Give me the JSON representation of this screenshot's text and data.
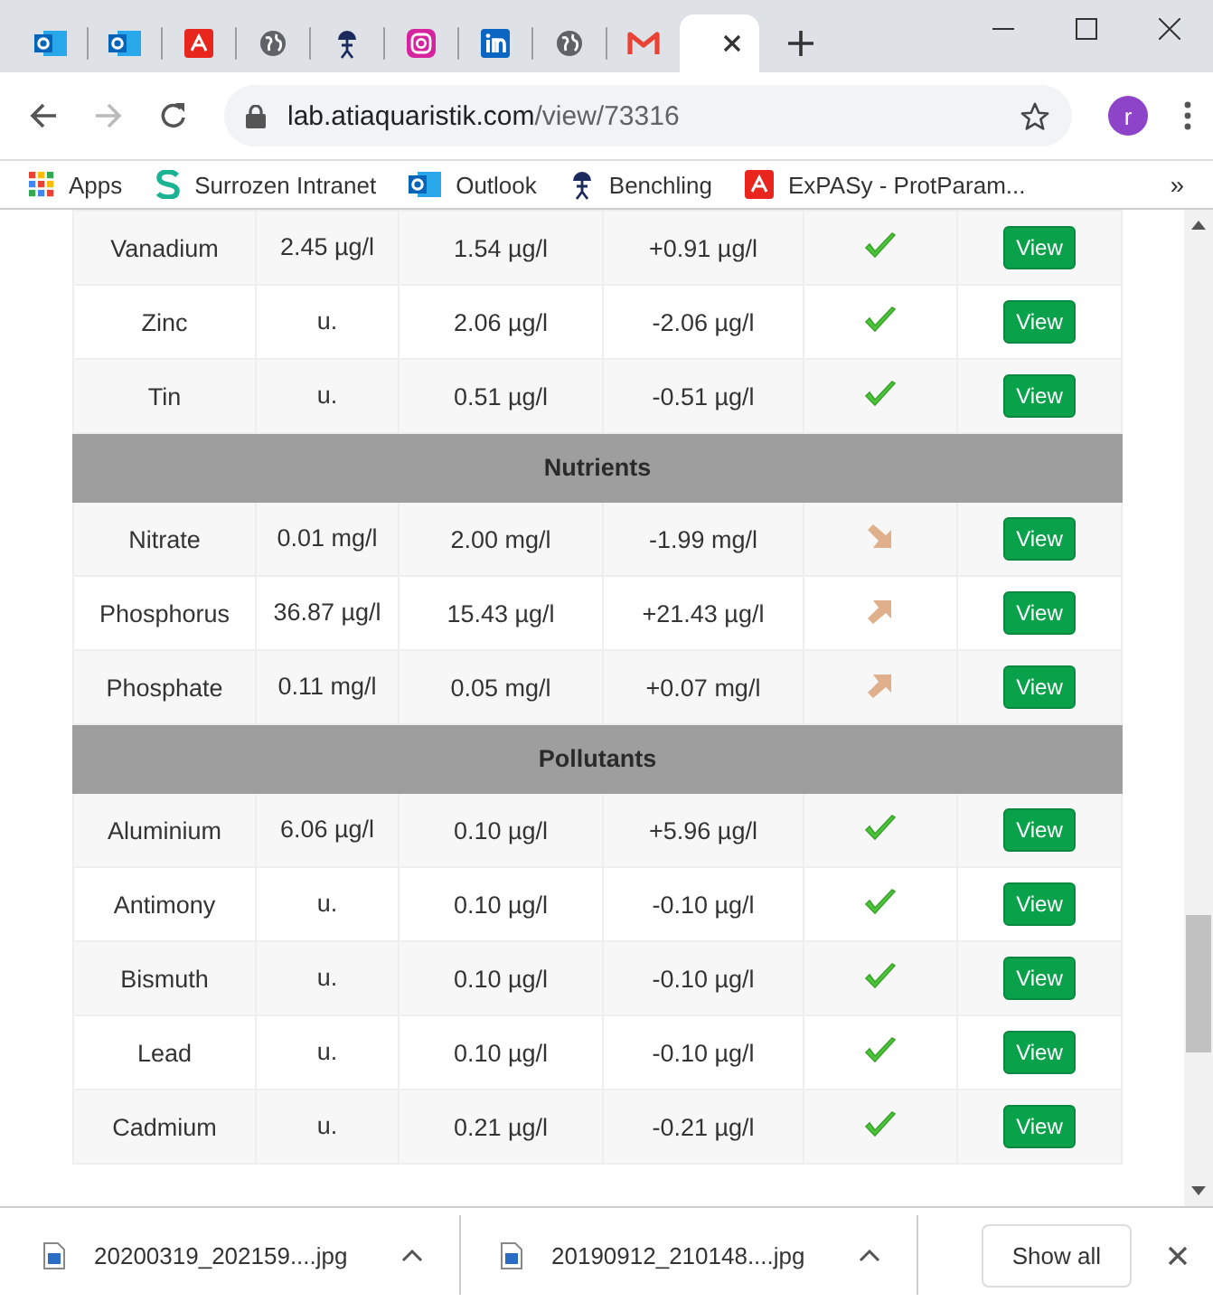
{
  "browser": {
    "tabs": [
      {
        "kind": "outlook",
        "selected": false
      },
      {
        "kind": "outlook",
        "selected": false
      },
      {
        "kind": "pdf",
        "selected": false
      },
      {
        "kind": "globe",
        "selected": false
      },
      {
        "kind": "figure",
        "selected": false
      },
      {
        "kind": "instagram",
        "selected": false
      },
      {
        "kind": "linkedin",
        "selected": false
      },
      {
        "kind": "globe",
        "selected": false
      },
      {
        "kind": "gmail",
        "selected": false
      },
      {
        "kind": "blank",
        "selected": true
      }
    ],
    "address": {
      "host": "lab.atiaquaristik.com",
      "path": "/view/73316"
    },
    "profile": "r",
    "bookmarks": [
      {
        "kind": "apps",
        "label": "Apps"
      },
      {
        "kind": "s",
        "label": "Surrozen Intranet"
      },
      {
        "kind": "outlook",
        "label": "Outlook"
      },
      {
        "kind": "figure",
        "label": "Benchling"
      },
      {
        "kind": "pdf",
        "label": "ExPASy - ProtParam..."
      }
    ],
    "bookmarks_more": "»"
  },
  "table": {
    "rows": [
      {
        "kind": "row",
        "name": "Vanadium",
        "measured": "2.45 µg/l",
        "target": "1.54 µg/l",
        "deviation": "+0.91 µg/l",
        "indicator": {
          "kind": "check"
        },
        "action": "View"
      },
      {
        "kind": "row",
        "name": "Zinc",
        "measured": "u.",
        "target": "2.06 µg/l",
        "deviation": "-2.06 µg/l",
        "indicator": {
          "kind": "check"
        },
        "action": "View"
      },
      {
        "kind": "row",
        "name": "Tin",
        "measured": "u.",
        "target": "0.51 µg/l",
        "deviation": "-0.51 µg/l",
        "indicator": {
          "kind": "check"
        },
        "action": "View"
      },
      {
        "kind": "group",
        "title": "Nutrients"
      },
      {
        "kind": "row",
        "name": "Nitrate",
        "measured": "0.01 mg/l",
        "target": "2.00 mg/l",
        "deviation": "-1.99 mg/l",
        "indicator": {
          "kind": "arrow_down"
        },
        "action": "View"
      },
      {
        "kind": "row",
        "name": "Phosphorus",
        "measured": "36.87 µg/l",
        "target": "15.43 µg/l",
        "deviation": "+21.43 µg/l",
        "indicator": {
          "kind": "arrow_up"
        },
        "action": "View"
      },
      {
        "kind": "row",
        "name": "Phosphate",
        "measured": "0.11 mg/l",
        "target": "0.05 mg/l",
        "deviation": "+0.07 mg/l",
        "indicator": {
          "kind": "arrow_up"
        },
        "action": "View"
      },
      {
        "kind": "group",
        "title": "Pollutants"
      },
      {
        "kind": "row",
        "name": "Aluminium",
        "measured": "6.06 µg/l",
        "target": "0.10 µg/l",
        "deviation": "+5.96 µg/l",
        "indicator": {
          "kind": "check"
        },
        "action": "View"
      },
      {
        "kind": "row",
        "name": "Antimony",
        "measured": "u.",
        "target": "0.10 µg/l",
        "deviation": "-0.10 µg/l",
        "indicator": {
          "kind": "check"
        },
        "action": "View"
      },
      {
        "kind": "row",
        "name": "Bismuth",
        "measured": "u.",
        "target": "0.10 µg/l",
        "deviation": "-0.10 µg/l",
        "indicator": {
          "kind": "check"
        },
        "action": "View"
      },
      {
        "kind": "row",
        "name": "Lead",
        "measured": "u.",
        "target": "0.10 µg/l",
        "deviation": "-0.10 µg/l",
        "indicator": {
          "kind": "check"
        },
        "action": "View"
      },
      {
        "kind": "row",
        "name": "Cadmium",
        "measured": "u.",
        "target": "0.21 µg/l",
        "deviation": "-0.21 µg/l",
        "indicator": {
          "kind": "check"
        },
        "action": "View"
      }
    ]
  },
  "downloads": {
    "items": [
      {
        "name": "20200319_202159....jpg"
      },
      {
        "name": "20190912_210148....jpg"
      }
    ],
    "show_all": "Show all"
  }
}
